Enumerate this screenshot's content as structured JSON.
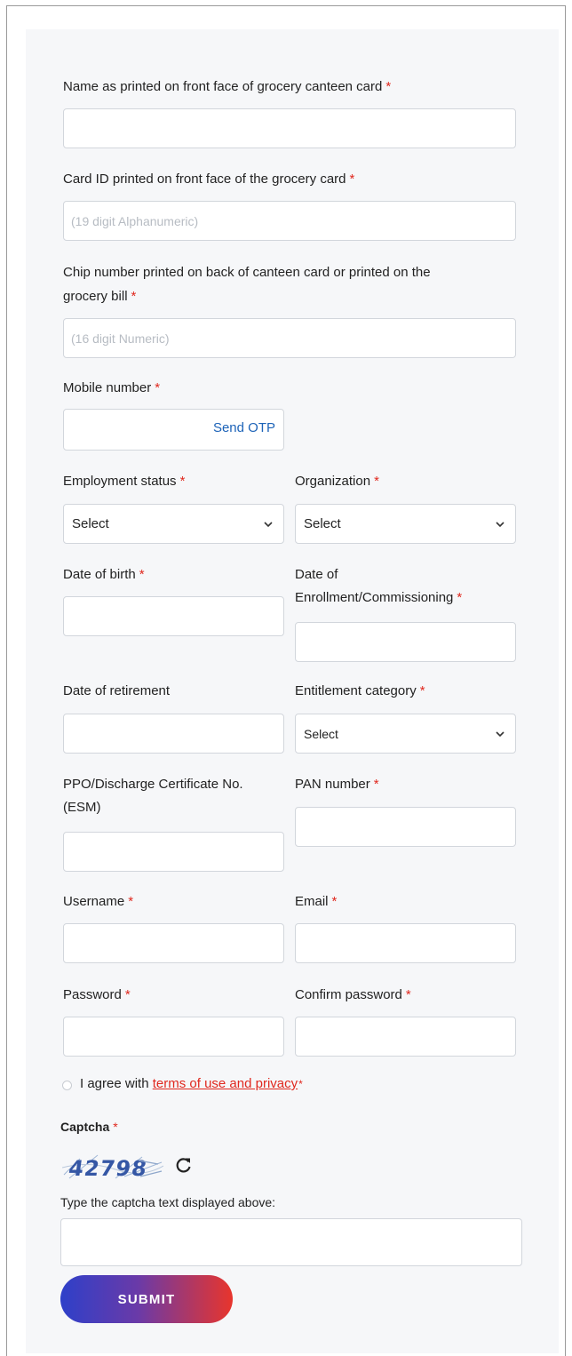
{
  "form": {
    "required_mark": "*",
    "name": {
      "label": "Name as printed on front face of grocery canteen card",
      "value": "",
      "placeholder": ""
    },
    "card_id": {
      "label": "Card ID printed on front face of the grocery card",
      "value": "",
      "placeholder": "(19 digit Alphanumeric)"
    },
    "chip": {
      "label_line1": "Chip number printed on back of canteen card or printed on the",
      "label_line2": "grocery bill",
      "value": "",
      "placeholder": "(16 digit Numeric)"
    },
    "mobile": {
      "label": "Mobile number",
      "value": "",
      "otp_button": "Send OTP"
    },
    "employment_status": {
      "label": "Employment status",
      "selected": "Select"
    },
    "organization": {
      "label": "Organization",
      "selected": "Select"
    },
    "dob": {
      "label": "Date of birth",
      "value": ""
    },
    "enrollment": {
      "label_line1": "Date of",
      "label_line2": "Enrollment/Commissioning",
      "value": ""
    },
    "retirement": {
      "label": "Date of retirement",
      "value": ""
    },
    "entitlement": {
      "label": "Entitlement category",
      "selected": "Select"
    },
    "ppo": {
      "label_line1": "PPO/Discharge Certificate No.",
      "label_line2": "(ESM)",
      "value": ""
    },
    "pan": {
      "label": "PAN number",
      "value": ""
    },
    "username": {
      "label": "Username",
      "value": ""
    },
    "email": {
      "label": "Email",
      "value": ""
    },
    "password": {
      "label": "Password",
      "value": ""
    },
    "confirm_password": {
      "label": "Confirm password",
      "value": ""
    },
    "agree": {
      "prefix": "I agree with",
      "link": "terms of use and privacy",
      "checked": false
    },
    "captcha": {
      "title": "Captcha",
      "code": "42798",
      "hint": "Type the captcha text displayed above:",
      "value": ""
    },
    "submit_label": "SUBMIT"
  },
  "colors": {
    "required": "#e0281e",
    "link": "#1d63b8",
    "panel_bg": "#f6f7f9",
    "submit_start": "#2e40c9",
    "submit_end": "#e8352c"
  }
}
